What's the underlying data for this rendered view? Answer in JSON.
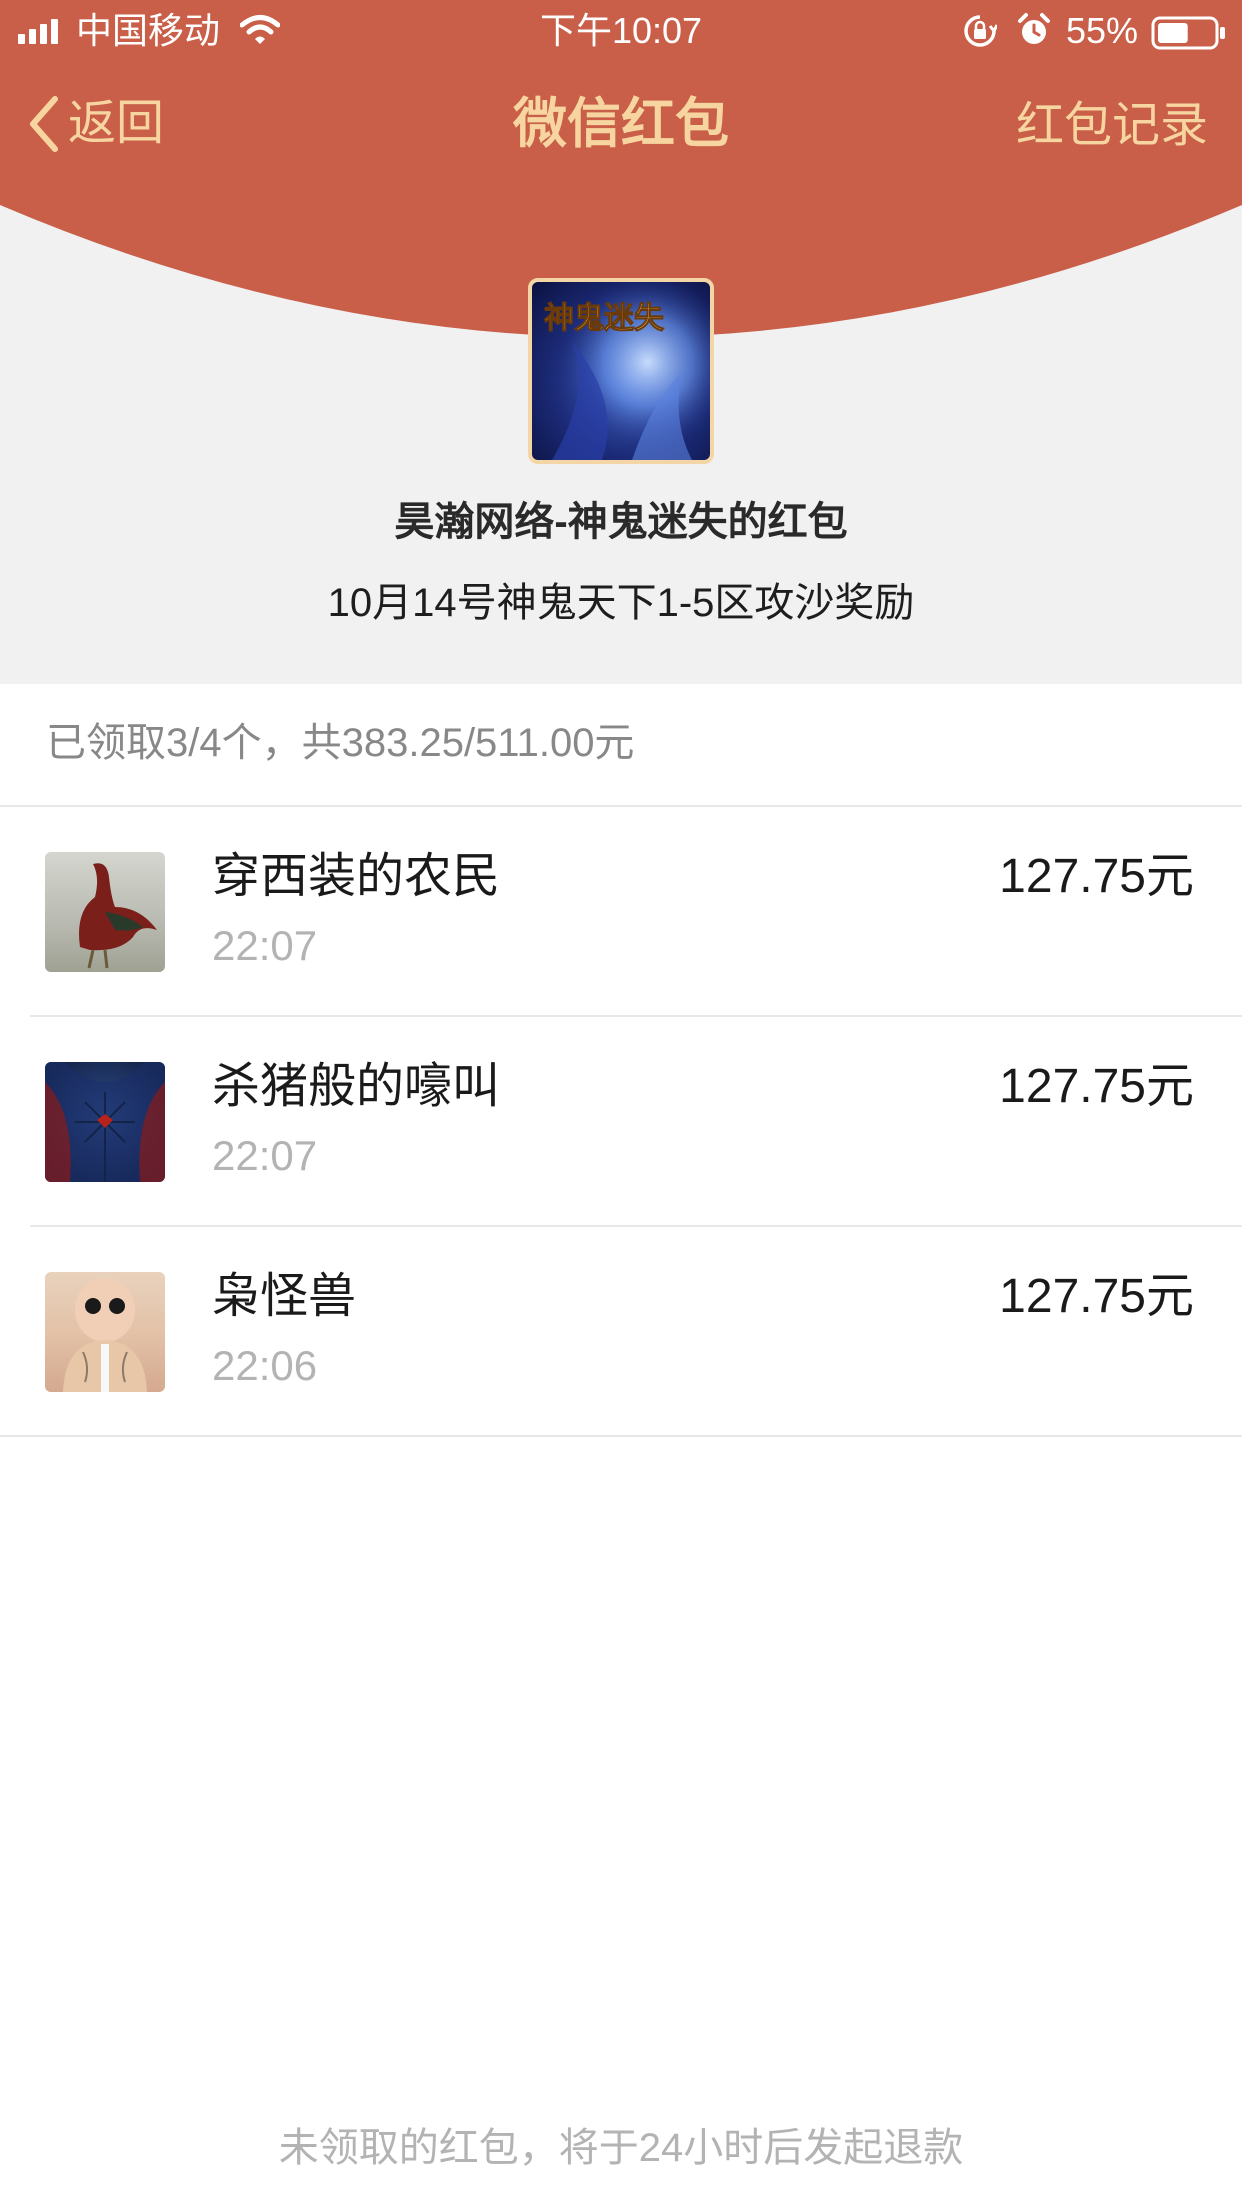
{
  "colors": {
    "header_red": "#c95f48",
    "gold_text": "#f7d5a0",
    "band_grey": "#f1f1f1"
  },
  "status_bar": {
    "carrier": "中国移动",
    "time": "下午10:07",
    "battery_percent": "55%",
    "battery_level": 0.55,
    "icons": [
      "signal-icon",
      "wifi-icon",
      "rotation-lock-icon",
      "alarm-icon",
      "battery-icon"
    ]
  },
  "nav": {
    "back_label": "返回",
    "title": "微信红包",
    "records_label": "红包记录"
  },
  "packet": {
    "sender": "昊瀚网络-神鬼迷失的红包",
    "greeting": "10月14号神鬼天下1-5区攻沙奖励",
    "avatar_text": "神鬼迷失"
  },
  "summary": "已领取3/4个，共383.25/511.00元",
  "recipients": [
    {
      "name": "穿西装的农民",
      "time": "22:07",
      "amount": "127.75元"
    },
    {
      "name": "杀猪般的嚎叫",
      "time": "22:07",
      "amount": "127.75元"
    },
    {
      "name": "枭怪兽",
      "time": "22:06",
      "amount": "127.75元"
    }
  ],
  "footer_note": "未领取的红包，将于24小时后发起退款"
}
